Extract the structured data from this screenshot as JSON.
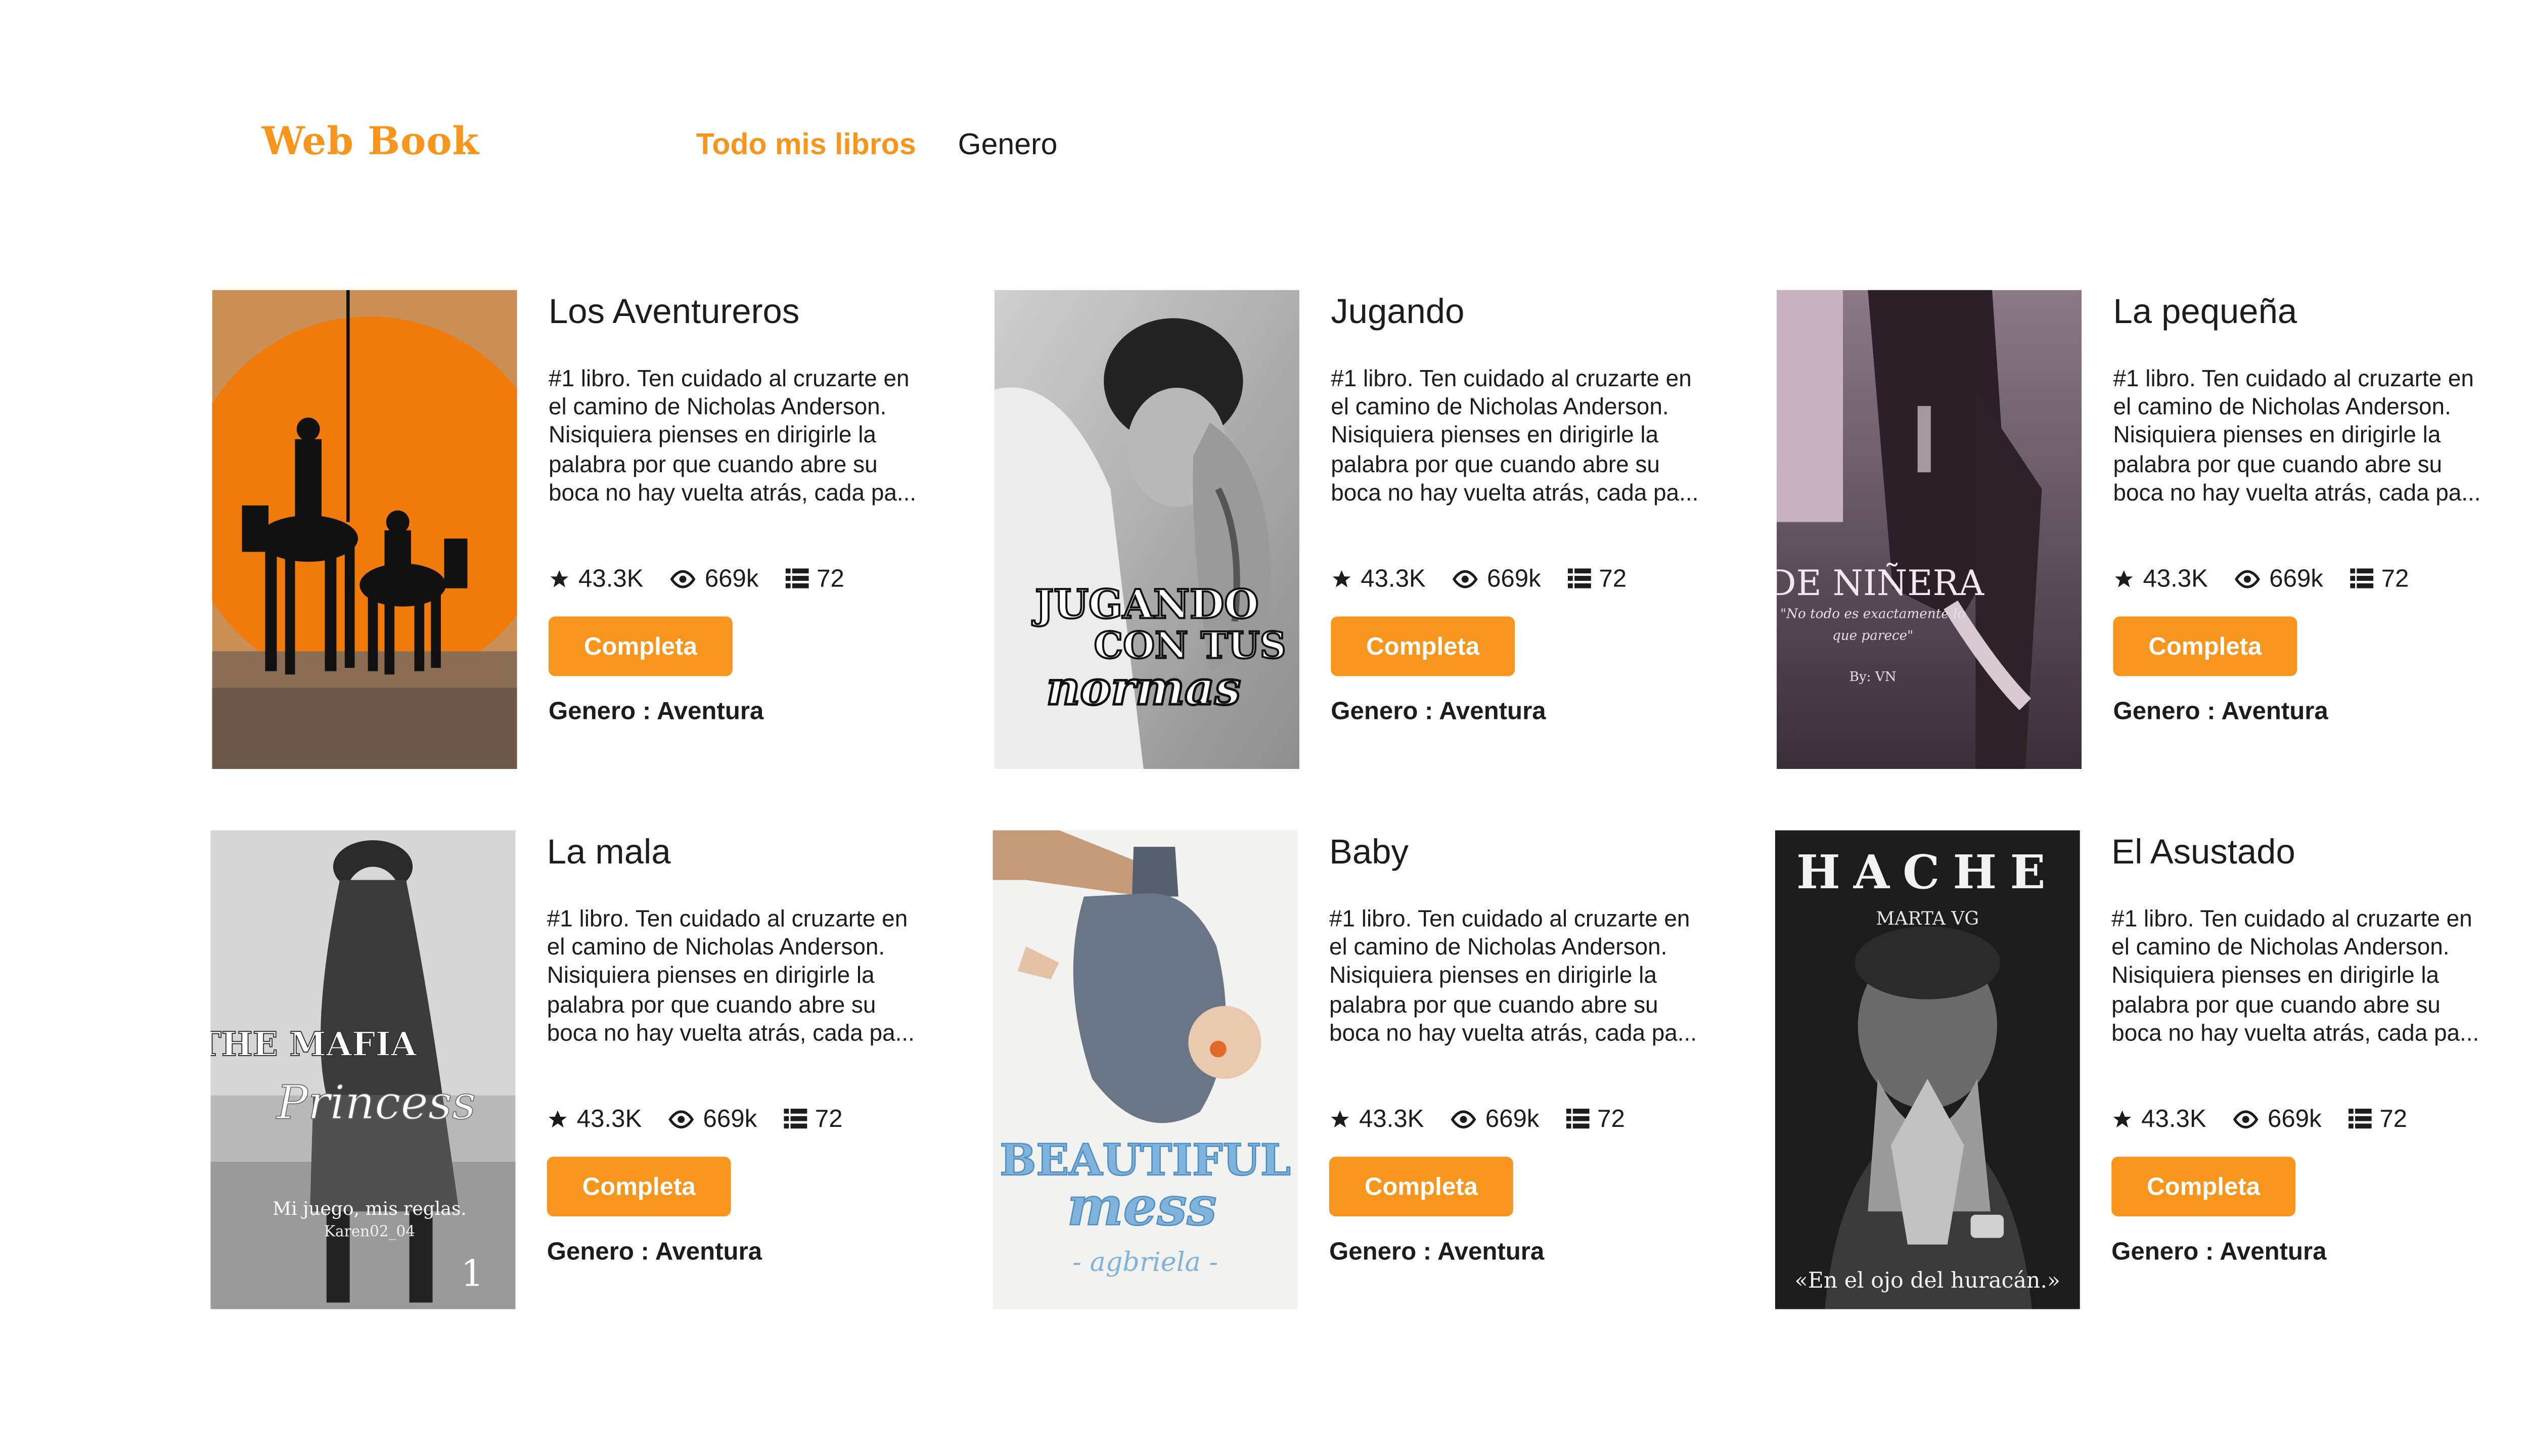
{
  "header": {
    "logo": "Web Book",
    "nav": [
      "Todo mis libros",
      "Genero"
    ]
  },
  "colors": {
    "accent": "#f7951d",
    "text": "#1c1c1c"
  },
  "books": [
    {
      "title": "Los Aventureros",
      "desc": "#1 libro. Ten cuidado al cruzarte en el camino de Nicholas Anderson. Nisiquiera pienses en dirigirle la palabra por que cuando abre su boca no hay vuelta atrás, cada pa...",
      "rating": "43.3K",
      "views": "669k",
      "parts": "72",
      "status": "Completa",
      "genre": "Genero : Aventura",
      "cover_text": []
    },
    {
      "title": "Jugando",
      "desc": "#1 libro. Ten cuidado al cruzarte en el camino de Nicholas Anderson. Nisiquiera pienses en dirigirle la palabra por que cuando abre su boca no hay vuelta atrás, cada pa...",
      "rating": "43.3K",
      "views": "669k",
      "parts": "72",
      "status": "Completa",
      "genre": "Genero : Aventura",
      "cover_text": [
        "JUGANDO",
        "CON TUS",
        "normas"
      ]
    },
    {
      "title": "La pequeña",
      "desc": "#1 libro. Ten cuidado al cruzarte en el camino de Nicholas Anderson. Nisiquiera pienses en dirigirle la palabra por que cuando abre su boca no hay vuelta atrás, cada pa...",
      "rating": "43.3K",
      "views": "669k",
      "parts": "72",
      "status": "Completa",
      "genre": "Genero : Aventura",
      "cover_text": [
        "DE NIÑERA",
        "\"No todo es exactamente lo",
        "que parece\"",
        "By: VN"
      ]
    },
    {
      "title": "La mala",
      "desc": "#1 libro. Ten cuidado al cruzarte en el camino de Nicholas Anderson. Nisiquiera pienses en dirigirle la palabra por que cuando abre su boca no hay vuelta atrás, cada pa...",
      "rating": "43.3K",
      "views": "669k",
      "parts": "72",
      "status": "Completa",
      "genre": "Genero : Aventura",
      "cover_text": [
        "THE MAFIA",
        "Princess",
        "Mi juego, mis reglas.",
        "Karen02_04",
        "1"
      ]
    },
    {
      "title": "Baby",
      "desc": "#1 libro. Ten cuidado al cruzarte en el camino de Nicholas Anderson. Nisiquiera pienses en dirigirle la palabra por que cuando abre su boca no hay vuelta atrás, cada pa...",
      "rating": "43.3K",
      "views": "669k",
      "parts": "72",
      "status": "Completa",
      "genre": "Genero : Aventura",
      "cover_text": [
        "BEAUTIFUL",
        "mess",
        "- agbriela -"
      ]
    },
    {
      "title": "El Asustado",
      "desc": "#1 libro. Ten cuidado al cruzarte en el camino de Nicholas Anderson. Nisiquiera pienses en dirigirle la palabra por que cuando abre su boca no hay vuelta atrás, cada pa...",
      "rating": "43.3K",
      "views": "669k",
      "parts": "72",
      "status": "Completa",
      "genre": "Genero : Aventura",
      "cover_text": [
        "HACHE",
        "MARTA VG",
        "«En el ojo del huracán.»"
      ]
    }
  ]
}
